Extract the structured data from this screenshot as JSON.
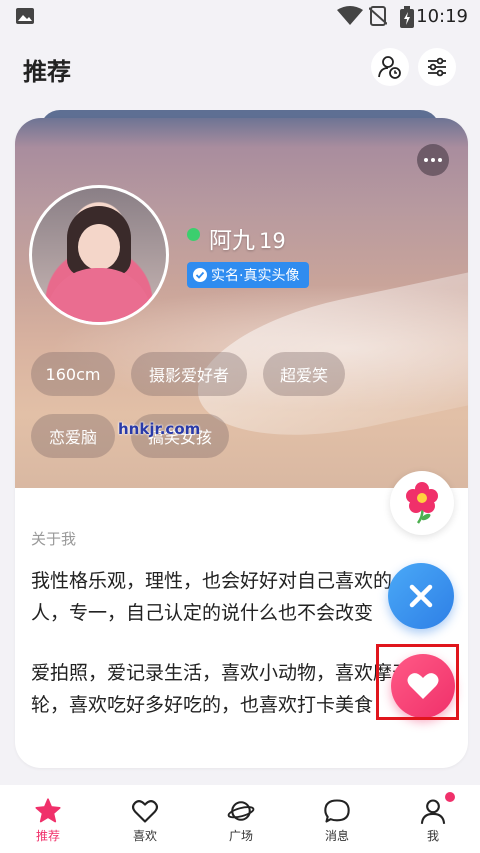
{
  "status_bar": {
    "time": "10:19"
  },
  "header": {
    "title": "推荐"
  },
  "profile": {
    "name": "阿九",
    "age": "19",
    "verification": "实名·真实头像",
    "tags": [
      "160cm",
      "摄影爱好者",
      "超爱笑",
      "恋爱脑",
      "搞笑女孩"
    ],
    "about_label": "关于我",
    "about_line1": "我性格乐观，理性，也会好好对自己喜欢的",
    "about_line2": "人，专一，自己认定的说什么也不会改变",
    "about_line3": "爱拍照，爱记录生活，喜欢小动物，喜欢摩天",
    "about_line4": "轮，喜欢吃好多好吃的，也喜欢打卡美食"
  },
  "watermark": "hnkjr.com",
  "nav": {
    "items": [
      {
        "label": "推荐",
        "icon": "star-icon"
      },
      {
        "label": "喜欢",
        "icon": "heart-icon"
      },
      {
        "label": "广场",
        "icon": "planet-icon"
      },
      {
        "label": "消息",
        "icon": "chat-icon"
      },
      {
        "label": "我",
        "icon": "person-icon"
      }
    ]
  },
  "colors": {
    "accent": "#f0306a",
    "blue": "#2e7fe6",
    "verify": "#2f8cf0",
    "online": "#3ccf6e"
  }
}
